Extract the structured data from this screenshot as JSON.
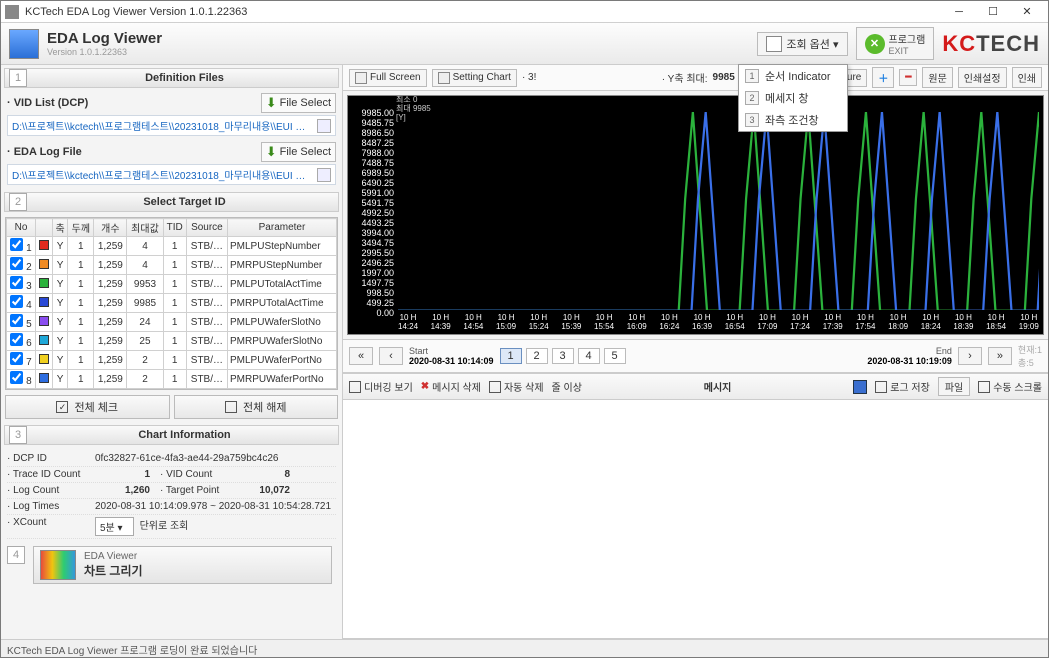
{
  "window": {
    "title": "KCTech EDA Log Viewer Version 1.0.1.22363"
  },
  "app": {
    "name": "EDA Log Viewer",
    "version": "Version 1.0.1.22363"
  },
  "header_buttons": {
    "lookup": "조회 옵션 ▾",
    "exit_label": "프로그램",
    "exit_sub": "EXIT"
  },
  "popup_items": [
    {
      "n": "1",
      "label": "순서 Indicator"
    },
    {
      "n": "2",
      "label": "메세지 창"
    },
    {
      "n": "3",
      "label": "좌측 조건창"
    }
  ],
  "brand": {
    "kc": "KC",
    "tech": "TECH"
  },
  "sections": {
    "s1": "Definition Files",
    "s2": "Select Target ID",
    "s3": "Chart Information"
  },
  "file_vid": {
    "label": "· VID List (DCP)",
    "btn": "File Select",
    "path": "D:\\\\프로젝트\\\\kctech\\\\프로그램테스트\\\\20231018_마무리내용\\\\EUI 추가"
  },
  "file_eda": {
    "label": "· EDA Log File",
    "btn": "File Select",
    "path": "D:\\\\프로젝트\\\\kctech\\\\프로그램테스트\\\\20231018_마무리내용\\\\EUI 추가"
  },
  "tbl": {
    "hdr": [
      "No",
      "",
      "축",
      "두께",
      "개수",
      "최대값",
      "TID",
      "Source",
      "Parameter"
    ],
    "rows": [
      {
        "no": 1,
        "color": "#e12a1f",
        "axis": "Y",
        "thk": 1,
        "cnt": "1,259",
        "max": 4,
        "tid": 1,
        "src": "STB/…",
        "param": "PMLPUStepNumber"
      },
      {
        "no": 2,
        "color": "#f08b24",
        "axis": "Y",
        "thk": 1,
        "cnt": "1,259",
        "max": 4,
        "tid": 1,
        "src": "STB/…",
        "param": "PMRPUStepNumber"
      },
      {
        "no": 3,
        "color": "#2bb23c",
        "axis": "Y",
        "thk": 1,
        "cnt": "1,259",
        "max": 9953,
        "tid": 1,
        "src": "STB/…",
        "param": "PMLPUTotalActTime"
      },
      {
        "no": 4,
        "color": "#2a49d6",
        "axis": "Y",
        "thk": 1,
        "cnt": "1,259",
        "max": 9985,
        "tid": 1,
        "src": "STB/…",
        "param": "PMRPUTotalActTime"
      },
      {
        "no": 5,
        "color": "#8a4df0",
        "axis": "Y",
        "thk": 1,
        "cnt": "1,259",
        "max": 24,
        "tid": 1,
        "src": "STB/…",
        "param": "PMLPUWaferSlotNo"
      },
      {
        "no": 6,
        "color": "#1fa8d8",
        "axis": "Y",
        "thk": 1,
        "cnt": "1,259",
        "max": 25,
        "tid": 1,
        "src": "STB/…",
        "param": "PMRPUWaferSlotNo"
      },
      {
        "no": 7,
        "color": "#f0d020",
        "axis": "Y",
        "thk": 1,
        "cnt": "1,259",
        "max": 2,
        "tid": 1,
        "src": "STB/…",
        "param": "PMLPUWaferPortNo"
      },
      {
        "no": 8,
        "color": "#2d6de0",
        "axis": "Y",
        "thk": 1,
        "cnt": "1,259",
        "max": 2,
        "tid": 1,
        "src": "STB/…",
        "param": "PMRPUWaferPortNo"
      }
    ]
  },
  "checkbtn": {
    "all": "전체 체크",
    "none": "전체 해제"
  },
  "info": {
    "dcp_k": "· DCP ID",
    "dcp_v": "0fc32827-61ce-4fa3-ae44-29a759bc4c26",
    "trace_k": "· Trace ID Count",
    "trace_v": "1",
    "vid_k": "· VID Count",
    "vid_v": "8",
    "log_k": "· Log Count",
    "log_v": "1,260",
    "tp_k": "· Target Point",
    "tp_v": "10,072",
    "lt_k": "· Log Times",
    "lt_v": "2020-08-31 10:14:09.978 ~ 2020-08-31 10:54:28.721",
    "xc_k": "· XCount",
    "xc_sel": "5분",
    "xc_unit": "단위로 조회"
  },
  "draw": {
    "title": "EDA Viewer",
    "btn": "차트 그리기"
  },
  "chart_tb": {
    "fullscreen": "Full Screen",
    "setting": "Setting Chart",
    "three": "· 3!",
    "ymax_lbl": "· Y축 최대:",
    "ymax_v": "9985",
    "capture": "Capture",
    "orig": "원문",
    "print1": "인쇄설정",
    "print2": "인쇄"
  },
  "chart_hover": {
    "l1": "최소 0",
    "l2": "최대 9985",
    "l3": "[Y]"
  },
  "pager": {
    "start_lbl": "Start",
    "start_v": "2020-08-31 10:14:09",
    "end_lbl": "End",
    "end_v": "2020-08-31 10:19:09",
    "pages": [
      "1",
      "2",
      "3",
      "4",
      "5"
    ],
    "cur_lbl": "현재:",
    "total_lbl": "총"
  },
  "msg": {
    "debug": "디버깅 보기",
    "delmsg": "메시지 삭제",
    "autodel": "자동 삭제",
    "over": "줄 이상",
    "center": "메시지",
    "savelog": "로그 저장",
    "file": "파일",
    "vscroll": "수동 스크롤"
  },
  "status": "KCTech EDA Log Viewer 프로그램 로딩이 완료 되었습니다",
  "chart_data": {
    "type": "line",
    "ylim": [
      0,
      9985
    ],
    "yticks": [
      0,
      499.25,
      998.5,
      1497.75,
      1997.0,
      2496.25,
      2995.5,
      3494.75,
      3994.0,
      4493.25,
      4992.5,
      5491.75,
      5991.0,
      6490.25,
      6989.5,
      7488.75,
      7988.0,
      8487.25,
      8986.5,
      9485.75,
      9985.0
    ],
    "xticks": [
      "10 H\n14:24",
      "10 H\n14:39",
      "10 H\n14:54",
      "10 H\n15:09",
      "10 H\n15:24",
      "10 H\n15:39",
      "10 H\n15:54",
      "10 H\n16:09",
      "10 H\n16:24",
      "10 H\n16:39",
      "10 H\n16:54",
      "10 H\n17:09",
      "10 H\n17:24",
      "10 H\n17:39",
      "10 H\n17:54",
      "10 H\n18:09",
      "10 H\n18:24",
      "10 H\n18:39",
      "10 H\n18:54",
      "10 H\n19:09"
    ],
    "peaks_green_x": [
      0.46,
      0.555,
      0.64,
      0.73,
      0.82,
      0.91,
      1.0
    ],
    "peaks_blue_x": [
      0.48,
      0.575,
      0.665,
      0.755,
      0.845,
      0.935,
      1.02
    ]
  }
}
